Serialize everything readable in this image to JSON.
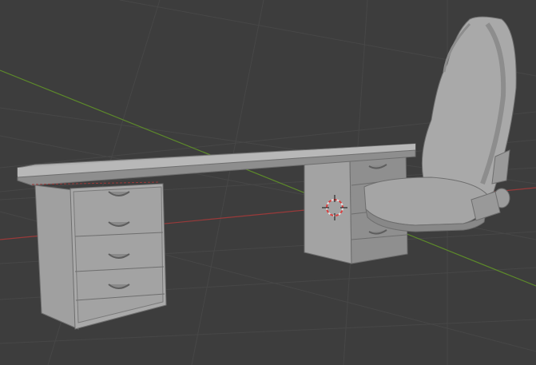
{
  "viewport": {
    "background": "#3d3d3d",
    "grid_color": "#474747",
    "x_axis_color": "#9a3a3a",
    "y_axis_color": "#5d8a2a"
  },
  "scene": {
    "objects": [
      "desk-top",
      "left-drawer-cabinet",
      "right-drawer-cabinet",
      "gaming-chair",
      "3d-cursor"
    ],
    "material_colors": {
      "light": "#a7a7a7",
      "mid": "#9a9a9a",
      "dark": "#8a8a8a",
      "shadow": "#777777",
      "edge": "#6e6e6e"
    },
    "cursor_icon": "3d-cursor-icon"
  }
}
